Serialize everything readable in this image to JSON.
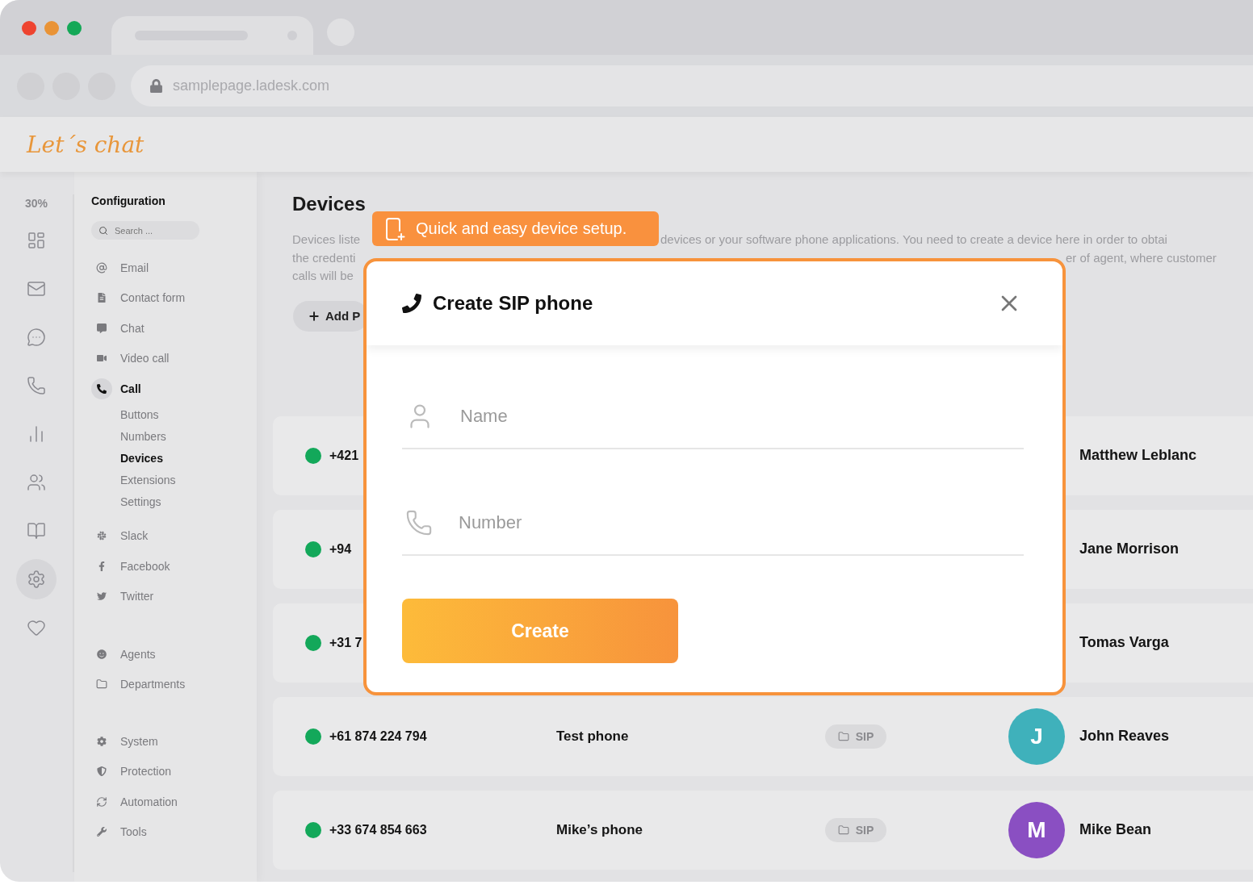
{
  "browser": {
    "url": "samplepage.ladesk.com"
  },
  "app": {
    "logo": "Let´s chat"
  },
  "rail": {
    "usage": "30%",
    "items": [
      {
        "selected": false
      },
      {
        "selected": false
      },
      {
        "selected": false
      },
      {
        "selected": false
      },
      {
        "selected": false
      },
      {
        "selected": false
      },
      {
        "selected": false
      },
      {
        "selected": true
      },
      {
        "selected": false
      }
    ]
  },
  "config": {
    "title": "Configuration",
    "search": {
      "placeholder": "Search ..."
    },
    "sections": [
      {
        "items": [
          {
            "label": "Email",
            "selected": false
          },
          {
            "label": "Contact form",
            "selected": false
          },
          {
            "label": "Chat",
            "selected": false
          },
          {
            "label": "Video call",
            "selected": false
          },
          {
            "label": "Call",
            "selected": true,
            "children": [
              {
                "label": "Buttons",
                "selected": false
              },
              {
                "label": "Numbers",
                "selected": false
              },
              {
                "label": "Devices",
                "selected": true
              },
              {
                "label": "Extensions",
                "selected": false
              },
              {
                "label": "Settings",
                "selected": false
              }
            ]
          }
        ]
      },
      {
        "items": [
          {
            "label": "Slack",
            "selected": false
          },
          {
            "label": "Facebook",
            "selected": false
          },
          {
            "label": "Twitter",
            "selected": false
          }
        ]
      },
      {
        "items": [
          {
            "label": "Agents",
            "selected": false
          },
          {
            "label": "Departments",
            "selected": false
          }
        ]
      },
      {
        "items": [
          {
            "label": "System",
            "selected": false
          },
          {
            "label": "Protection",
            "selected": false
          },
          {
            "label": "Automation",
            "selected": false
          },
          {
            "label": "Tools",
            "selected": false
          }
        ]
      }
    ]
  },
  "page": {
    "title": "Devices",
    "description": [
      {
        "left": "Devices liste",
        "right": "devices or your software phone applications. You need to create a device here in order to obtai"
      },
      {
        "left": "the credenti",
        "right": "er of agent, where customer"
      },
      {
        "left": "calls will be"
      }
    ],
    "add_button": "Add P"
  },
  "devices": [
    {
      "phone": "+421",
      "agent": "Matthew Leblanc"
    },
    {
      "phone": "+94",
      "agent": "Jane Morrison"
    },
    {
      "phone": "+31 7",
      "agent": "Tomas Varga"
    },
    {
      "phone": "+61 874 224 794",
      "device": "Test phone",
      "type": "SIP",
      "avatar": "J",
      "color": "#3fb1bb",
      "agent": "John Reaves"
    },
    {
      "phone": "+33 674 854 663",
      "device": "Mike’s phone",
      "type": "SIP",
      "avatar": "M",
      "color": "#8a4fc2",
      "agent": "Mike Bean"
    }
  ],
  "tooltip": {
    "text": "Quick and easy device setup."
  },
  "modal": {
    "title": "Create SIP phone",
    "fields": [
      {
        "placeholder": "Name"
      },
      {
        "placeholder": "Number"
      }
    ],
    "submit": "Create"
  }
}
